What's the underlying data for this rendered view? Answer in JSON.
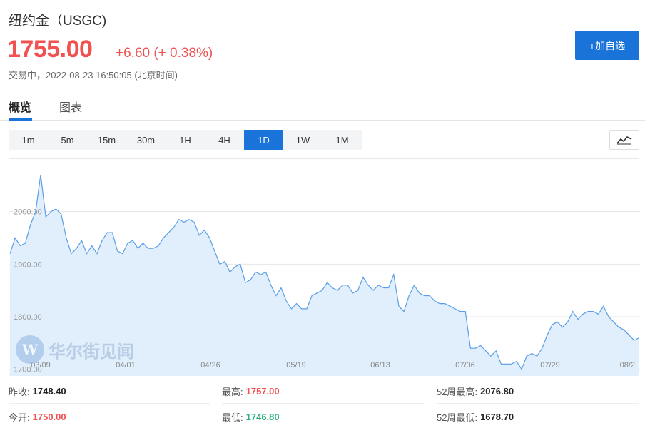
{
  "header": {
    "title": "纽约金（USGC)",
    "price": "1755.00",
    "change": "+6.60 (+ 0.38%)",
    "status": "交易中，2022-08-23 16:50:05 (北京时间)",
    "add_label": "+加自选"
  },
  "tabs": [
    "概览",
    "图表"
  ],
  "periods": [
    "1m",
    "5m",
    "15m",
    "30m",
    "1H",
    "4H",
    "1D",
    "1W",
    "1M"
  ],
  "active_period": "1D",
  "watermark": {
    "text": "华尔街见闻"
  },
  "stats": {
    "prev_close_label": "昨收:",
    "prev_close": "1748.40",
    "open_label": "今开:",
    "open": "1750.00",
    "high_label": "最高:",
    "high": "1757.00",
    "low_label": "最低:",
    "low": "1746.80",
    "high52_label": "52周最高:",
    "high52": "2076.80",
    "low52_label": "52周最低:",
    "low52": "1678.70"
  },
  "colors": {
    "accent": "#1a73d8",
    "up": "#f05252",
    "down": "#2ab07a",
    "line": "#5a9ee6",
    "area": "#e1eefb"
  },
  "chart_data": {
    "type": "area",
    "ylabels": [
      "2000.00",
      "1900.00",
      "1800.00",
      "1700.00"
    ],
    "y_ticks": [
      2000,
      1900,
      1800,
      1700
    ],
    "ylim": [
      1690,
      2100
    ],
    "xlabels": [
      "03/09",
      "04/01",
      "04/26",
      "05/19",
      "06/13",
      "07/06",
      "07/29",
      "08/2"
    ],
    "values": [
      1920,
      1950,
      1935,
      1940,
      1975,
      2000,
      2070,
      1990,
      2000,
      2005,
      1995,
      1950,
      1920,
      1930,
      1945,
      1920,
      1935,
      1920,
      1945,
      1960,
      1960,
      1925,
      1920,
      1940,
      1945,
      1930,
      1940,
      1930,
      1930,
      1935,
      1950,
      1960,
      1970,
      1985,
      1980,
      1985,
      1980,
      1955,
      1965,
      1950,
      1925,
      1900,
      1905,
      1885,
      1895,
      1900,
      1865,
      1870,
      1885,
      1880,
      1885,
      1860,
      1840,
      1855,
      1830,
      1815,
      1825,
      1815,
      1815,
      1840,
      1845,
      1850,
      1865,
      1855,
      1850,
      1860,
      1860,
      1845,
      1850,
      1875,
      1860,
      1850,
      1860,
      1855,
      1855,
      1880,
      1820,
      1810,
      1840,
      1860,
      1845,
      1840,
      1840,
      1830,
      1825,
      1825,
      1820,
      1815,
      1810,
      1810,
      1740,
      1740,
      1745,
      1735,
      1725,
      1735,
      1710,
      1710,
      1710,
      1715,
      1700,
      1725,
      1730,
      1725,
      1740,
      1765,
      1785,
      1790,
      1780,
      1790,
      1810,
      1795,
      1805,
      1810,
      1810,
      1805,
      1820,
      1800,
      1790,
      1780,
      1775,
      1765,
      1755,
      1760
    ]
  }
}
